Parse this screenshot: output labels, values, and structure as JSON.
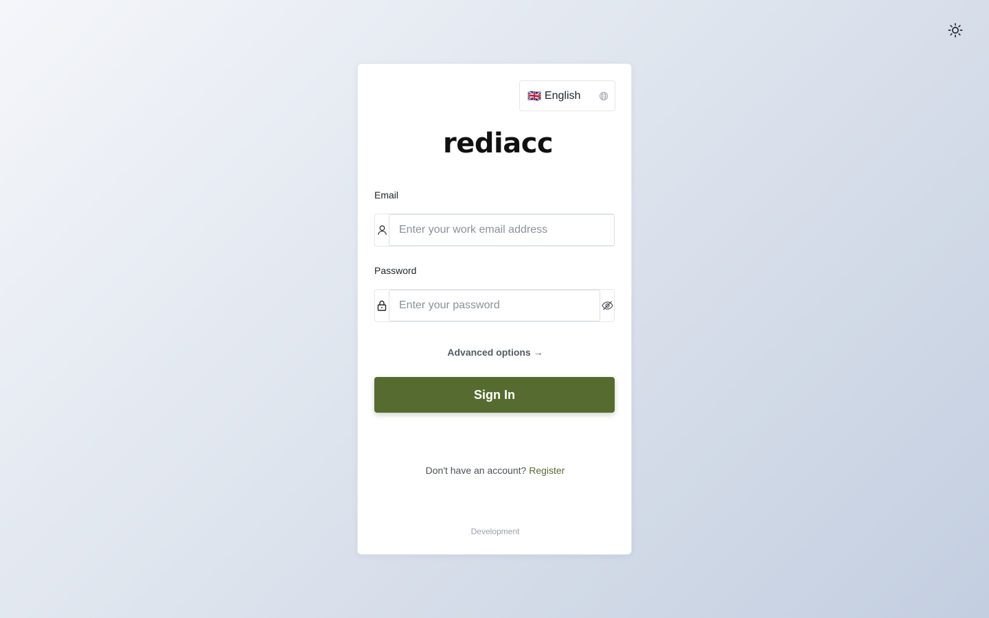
{
  "theme_toggle": {
    "icon": "sun-icon"
  },
  "language": {
    "flag": "🇬🇧",
    "label": "English",
    "icon": "globe-icon"
  },
  "logo": {
    "text": "rediacc"
  },
  "email": {
    "label": "Email",
    "placeholder": "Enter your work email address",
    "value": "",
    "icon": "user-icon"
  },
  "password": {
    "label": "Password",
    "placeholder": "Enter your password",
    "value": "",
    "icon": "lock-icon",
    "toggle_icon": "eye-off-icon"
  },
  "advanced": {
    "label": "Advanced options",
    "arrow": "→"
  },
  "signin": {
    "label": "Sign In"
  },
  "register": {
    "prompt": "Don't have an account?",
    "link": "Register"
  },
  "environment": {
    "label": "Development"
  },
  "colors": {
    "primary": "#566b30",
    "card_bg": "#ffffff"
  }
}
